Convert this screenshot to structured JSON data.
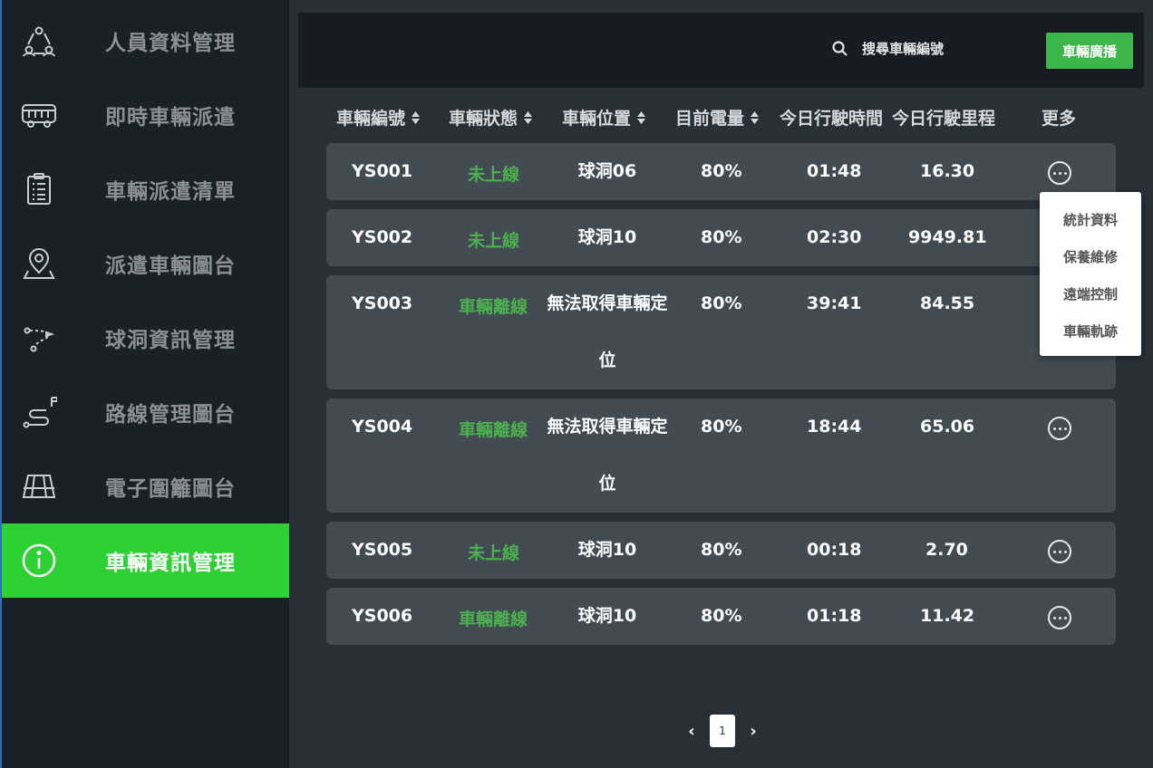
{
  "sidebar": {
    "items": [
      {
        "label": "人員資料管理",
        "icon": "people-network-icon"
      },
      {
        "label": "即時車輛派遣",
        "icon": "bus-icon"
      },
      {
        "label": "車輛派遣清單",
        "icon": "clipboard-list-icon"
      },
      {
        "label": "派遣車輛圖台",
        "icon": "map-pin-icon"
      },
      {
        "label": "球洞資訊管理",
        "icon": "golf-path-icon"
      },
      {
        "label": "路線管理圖台",
        "icon": "route-icon"
      },
      {
        "label": "電子圍籬圖台",
        "icon": "fence-grid-icon"
      },
      {
        "label": "車輛資訊管理",
        "icon": "info-icon",
        "active": true
      }
    ]
  },
  "header": {
    "search_placeholder": "搜尋車輛編號",
    "broadcast_label": "車輛廣播"
  },
  "table": {
    "columns": [
      "車輛編號",
      "車輛狀態",
      "車輛位置",
      "目前電量",
      "今日行駛時間",
      "今日行駛里程",
      "更多"
    ],
    "rows": [
      {
        "id": "YS001",
        "status": "未上線",
        "location": "球洞06",
        "battery": "80%",
        "time": "01:48",
        "distance": "16.30"
      },
      {
        "id": "YS002",
        "status": "未上線",
        "location": "球洞10",
        "battery": "80%",
        "time": "02:30",
        "distance": "9949.81"
      },
      {
        "id": "YS003",
        "status": "車輛離線",
        "location": "無法取得車輛定位",
        "battery": "80%",
        "time": "39:41",
        "distance": "84.55"
      },
      {
        "id": "YS004",
        "status": "車輛離線",
        "location": "無法取得車輛定位",
        "battery": "80%",
        "time": "18:44",
        "distance": "65.06"
      },
      {
        "id": "YS005",
        "status": "未上線",
        "location": "球洞10",
        "battery": "80%",
        "time": "00:18",
        "distance": "2.70"
      },
      {
        "id": "YS006",
        "status": "車輛離線",
        "location": "球洞10",
        "battery": "80%",
        "time": "01:18",
        "distance": "11.42"
      }
    ]
  },
  "more_menu": {
    "items": [
      "統計資料",
      "保養維修",
      "遠端控制",
      "車輛軌跡"
    ]
  },
  "pagination": {
    "current_page": "1",
    "prev": "‹",
    "next": "›"
  },
  "colors": {
    "accent_green": "#2ed134",
    "button_green": "#3cb54a",
    "status_green": "#4caf50"
  }
}
